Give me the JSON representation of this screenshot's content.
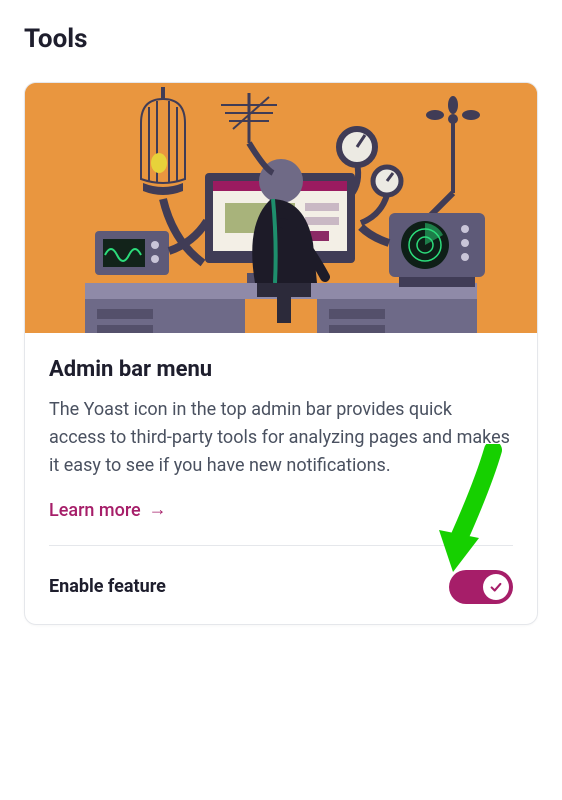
{
  "page": {
    "title": "Tools"
  },
  "card": {
    "heading": "Admin bar menu",
    "description": "The Yoast icon in the top admin bar provides quick access to third-party tools for analyzing pages and makes it easy to see if you have new notifications.",
    "learnMoreLabel": "Learn more",
    "toggle": {
      "label": "Enable feature",
      "enabled": true
    },
    "colors": {
      "accent": "#a61e69",
      "illustrationBg": "#e9963f"
    }
  }
}
